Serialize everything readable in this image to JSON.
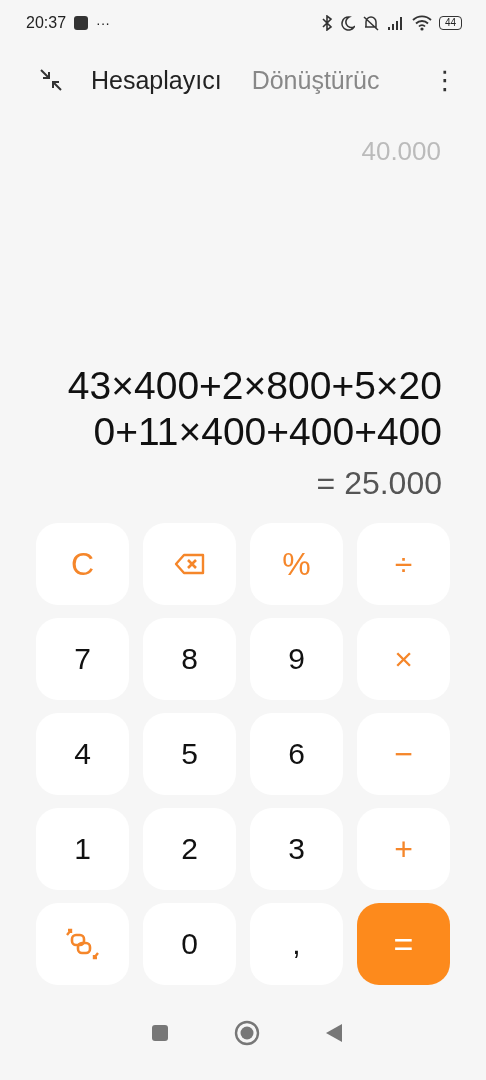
{
  "status_bar": {
    "time": "20:37",
    "dots": "···",
    "battery": "44"
  },
  "tabs": [
    {
      "label": "Hesaplayıcı",
      "selected": true
    },
    {
      "label": "Dönüştürüc",
      "selected": false
    }
  ],
  "menu": "⋮",
  "history": {
    "result": "40.000"
  },
  "display": {
    "expression": "43×400+2×800+5×200+11×400+400+400",
    "result": "= 25.000"
  },
  "keys": [
    {
      "kind": "operator",
      "label": "C"
    },
    {
      "kind": "backspace"
    },
    {
      "kind": "operator",
      "label": "%"
    },
    {
      "kind": "operator",
      "label": "÷"
    },
    {
      "kind": "digit",
      "label": "7"
    },
    {
      "kind": "digit",
      "label": "8"
    },
    {
      "kind": "digit",
      "label": "9"
    },
    {
      "kind": "operator",
      "label": "×"
    },
    {
      "kind": "digit",
      "label": "4"
    },
    {
      "kind": "digit",
      "label": "5"
    },
    {
      "kind": "digit",
      "label": "6"
    },
    {
      "kind": "operator",
      "label": "−"
    },
    {
      "kind": "digit",
      "label": "1"
    },
    {
      "kind": "digit",
      "label": "2"
    },
    {
      "kind": "digit",
      "label": "3"
    },
    {
      "kind": "operator",
      "label": "+"
    },
    {
      "kind": "switch"
    },
    {
      "kind": "digit",
      "label": "0"
    },
    {
      "kind": "digit",
      "label": ","
    },
    {
      "kind": "equals",
      "label": "="
    }
  ]
}
